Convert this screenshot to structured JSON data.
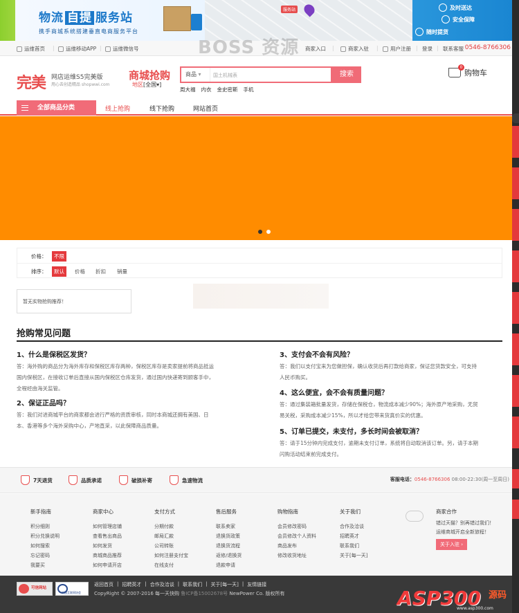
{
  "banner": {
    "title_a": "物流",
    "title_b": "自提",
    "title_c": "服务站",
    "subtitle": "携手商城系统搭建垂直电商服务平台",
    "map_tag": "服务站",
    "services": [
      "及时送达",
      "安全保障",
      "随时提货"
    ]
  },
  "topbar": {
    "home": "运维首页",
    "mobile": "运维移动APP",
    "wechat": "运维微信号",
    "right": [
      "商家入口",
      "商家入驻",
      "用户注册",
      "登录",
      "联系客服"
    ],
    "phone": "0546-8766306"
  },
  "watermark": "BOSS 资源",
  "header": {
    "logo": "完美",
    "logo_line1": "网店运维S5完美版",
    "logo_line2": "用心去创造精品 shopwwi.com",
    "mall_title": "商城抢购",
    "region_label": "地区",
    "region_value": "[全国▾]",
    "search_category": "商品",
    "search_placeholder": "国土机械表",
    "search_button": "搜索",
    "hotwords": [
      "周大福",
      "内衣",
      "金史密斯",
      "手机"
    ],
    "cart_label": "购物车",
    "cart_count": "0"
  },
  "nav": {
    "all_categories": "全部商品分类",
    "links": [
      "线上抢购",
      "线下抢购",
      "网站首页"
    ]
  },
  "filters": {
    "price_label": "价格：",
    "price_value": "不限",
    "sort_label": "排序：",
    "sort_options": [
      "默认",
      "价格",
      "折扣",
      "销量"
    ]
  },
  "empty_message": "暂无实物抢购推荐！",
  "faq": {
    "title": "抢购常见问题",
    "left": [
      {
        "q": "1、什么是保税区发货？",
        "a1": "答：海外购的商品分为海外库存和保税区库存两种，保税区库存是卖家提前将商品抵运",
        "a2": "国内保税区，在接收订单后直接从国内保税区仓库发货，通过国内快递寄到顾客手中，",
        "a3": "全程经由海关监管。"
      },
      {
        "q": "2、保证正品吗？",
        "a1": "答：我们对进商城平台的商家都会进行严格的资质审核，同时本商城还拥有美国、日",
        "a2": "本、香港等多个海外采购中心，产地直采，以此保障商品质量。",
        "a3": ""
      }
    ],
    "right": [
      {
        "q": "3、支付会不会有风险？",
        "a1": "答：我们以支付宝来为您做担保，确认收货后再打款给商家，保证您货款安全，可支持",
        "a2": "人民币购买。"
      },
      {
        "q": "4、这么便宜，会不会有质量问题？",
        "a1": "答：通过集装箱批量发货，存储在保税仓，物流成本减少90%；海外原产地采购，无贸",
        "a2": "易关税，采购成本减少15%，所以才给您带来货真价实的优惠。"
      },
      {
        "q": "5、订单已提交，未支付，多长时间会被取消？",
        "a1": "答：请于15分钟内完成支付，逾期未支付订单，系统将自动取消该订单。另，请于本期",
        "a2": "闪购活动结束前完成支付。"
      }
    ]
  },
  "guarantee": {
    "items": [
      "7天退货",
      "品质承诺",
      "破损补寄",
      "急速物流"
    ],
    "service_label": "客服电话：",
    "service_phone": "0546-8766306",
    "service_hours": "08:00-22:30(周一至周日)"
  },
  "footer_columns": [
    {
      "title": "新手指南",
      "links": [
        "积分细则",
        "积分兑换说明",
        "如何搜索",
        "忘记密码",
        "我要买"
      ]
    },
    {
      "title": "商家中心",
      "links": [
        "如何管理店铺",
        "查看售出商品",
        "如何发货",
        "商城商品推荐",
        "如何申请开店"
      ]
    },
    {
      "title": "支付方式",
      "links": [
        "分期付款",
        "邮局汇款",
        "公司转账",
        "如何注册支付宝",
        "在线支付"
      ]
    },
    {
      "title": "售后服务",
      "links": [
        "联系卖家",
        "退换货政策",
        "退换货流程",
        "返修/退换货",
        "退款申请"
      ]
    },
    {
      "title": "购物指南",
      "links": [
        "会员修改密码",
        "会员修改个人资料",
        "商品发布",
        "修改收货地址"
      ]
    },
    {
      "title": "关于我们",
      "links": [
        "合作及洽谈",
        "招聘英才",
        "联系我们",
        "关于[每一天]"
      ]
    }
  ],
  "partner": {
    "title": "商家合作",
    "line1": "错过天猫？别再错过我们！",
    "line2": "运维商城开启全新旅程！",
    "button": "关于入驻 ›"
  },
  "bottom": {
    "links": [
      "返回首页",
      "|",
      "招聘英才",
      "|",
      "合作及洽谈",
      "|",
      "联系我们",
      "|",
      "关于[每一天]",
      "|",
      "友情链接"
    ],
    "copyright": "CopyRight © 2007-2016 每一天快购",
    "icp": "鲁ICP备15002678号",
    "power": "NewPower Co. 版权所有",
    "badge1": "可信网站",
    "badge2": "中国互联网协会"
  },
  "asp_logo": {
    "text": "ASP300",
    "code": "源码",
    "url": "www.asp300.com"
  },
  "colors": {
    "brand_red": "#e84e4e",
    "search_pink": "#f06b77",
    "slider_orange": "#ff8c00",
    "footer_dark": "#393939"
  }
}
